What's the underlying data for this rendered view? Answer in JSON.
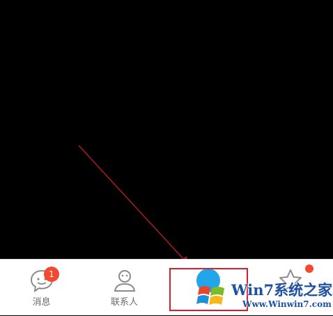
{
  "tabbar": {
    "tabs": [
      {
        "label": "消息",
        "icon": "chat-bubble-icon",
        "badge": "1"
      },
      {
        "label": "联系人",
        "icon": "contacts-person-icon"
      },
      {
        "label": "",
        "icon": "dynamic-icon",
        "active": true
      },
      {
        "label": "",
        "icon": "star-icon",
        "has_dot_badge": true
      }
    ]
  },
  "annotation": {
    "arrow_color": "#b01c23",
    "highlight_color": "#d81e2c"
  },
  "watermark": {
    "title": "Win7系统之家",
    "url": "Www.Winwin7.com"
  },
  "colors": {
    "badge": "#f2492f",
    "active_tab": "#21a6ea",
    "watermark_text": "#1d4fa5"
  }
}
